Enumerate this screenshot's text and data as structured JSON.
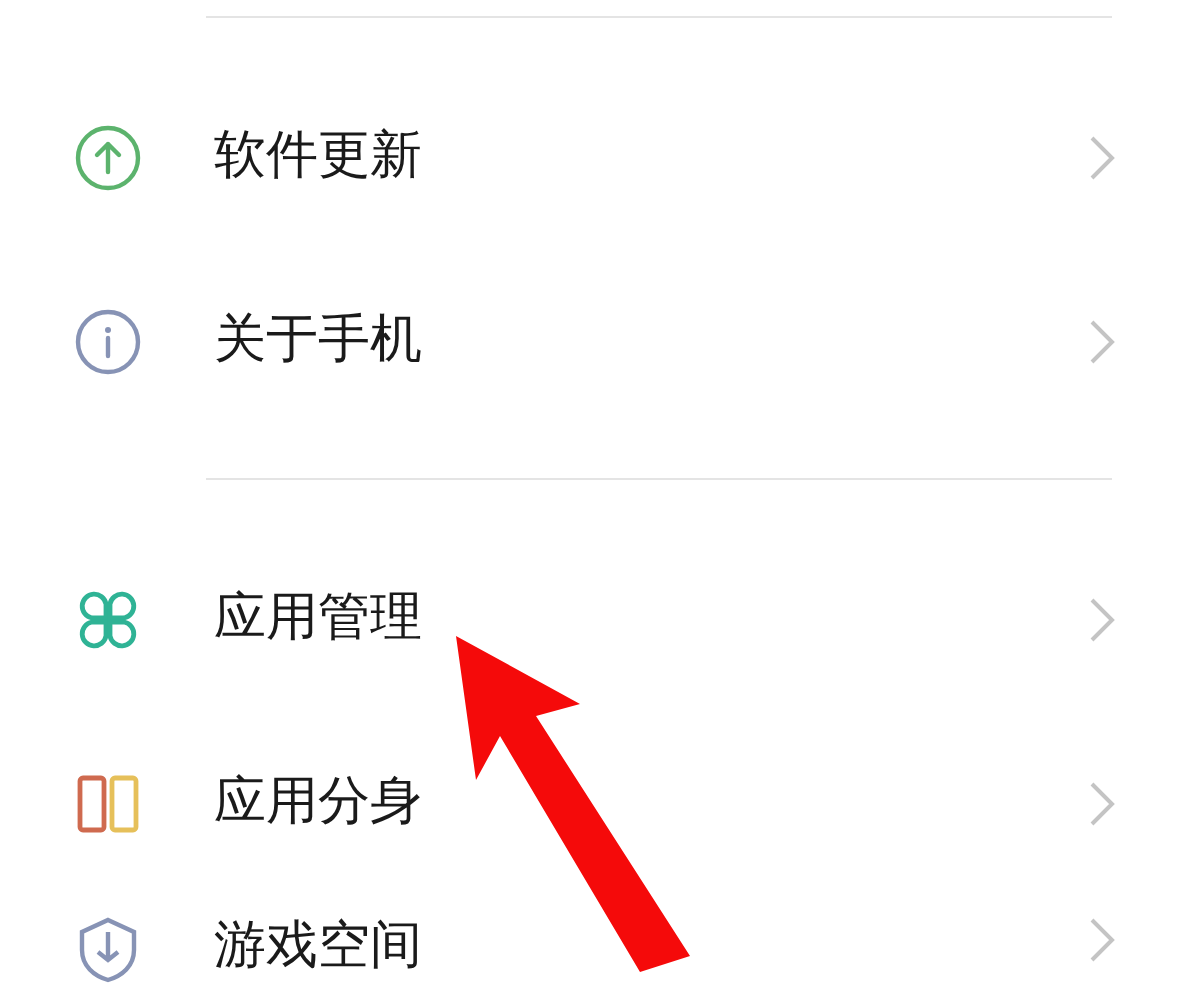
{
  "settings_groups": [
    {
      "items": [
        {
          "label": "软件更新"
        },
        {
          "label": "关于手机"
        }
      ]
    },
    {
      "items": [
        {
          "label": "应用管理"
        },
        {
          "label": "应用分身"
        },
        {
          "label": "游戏空间"
        }
      ]
    }
  ]
}
